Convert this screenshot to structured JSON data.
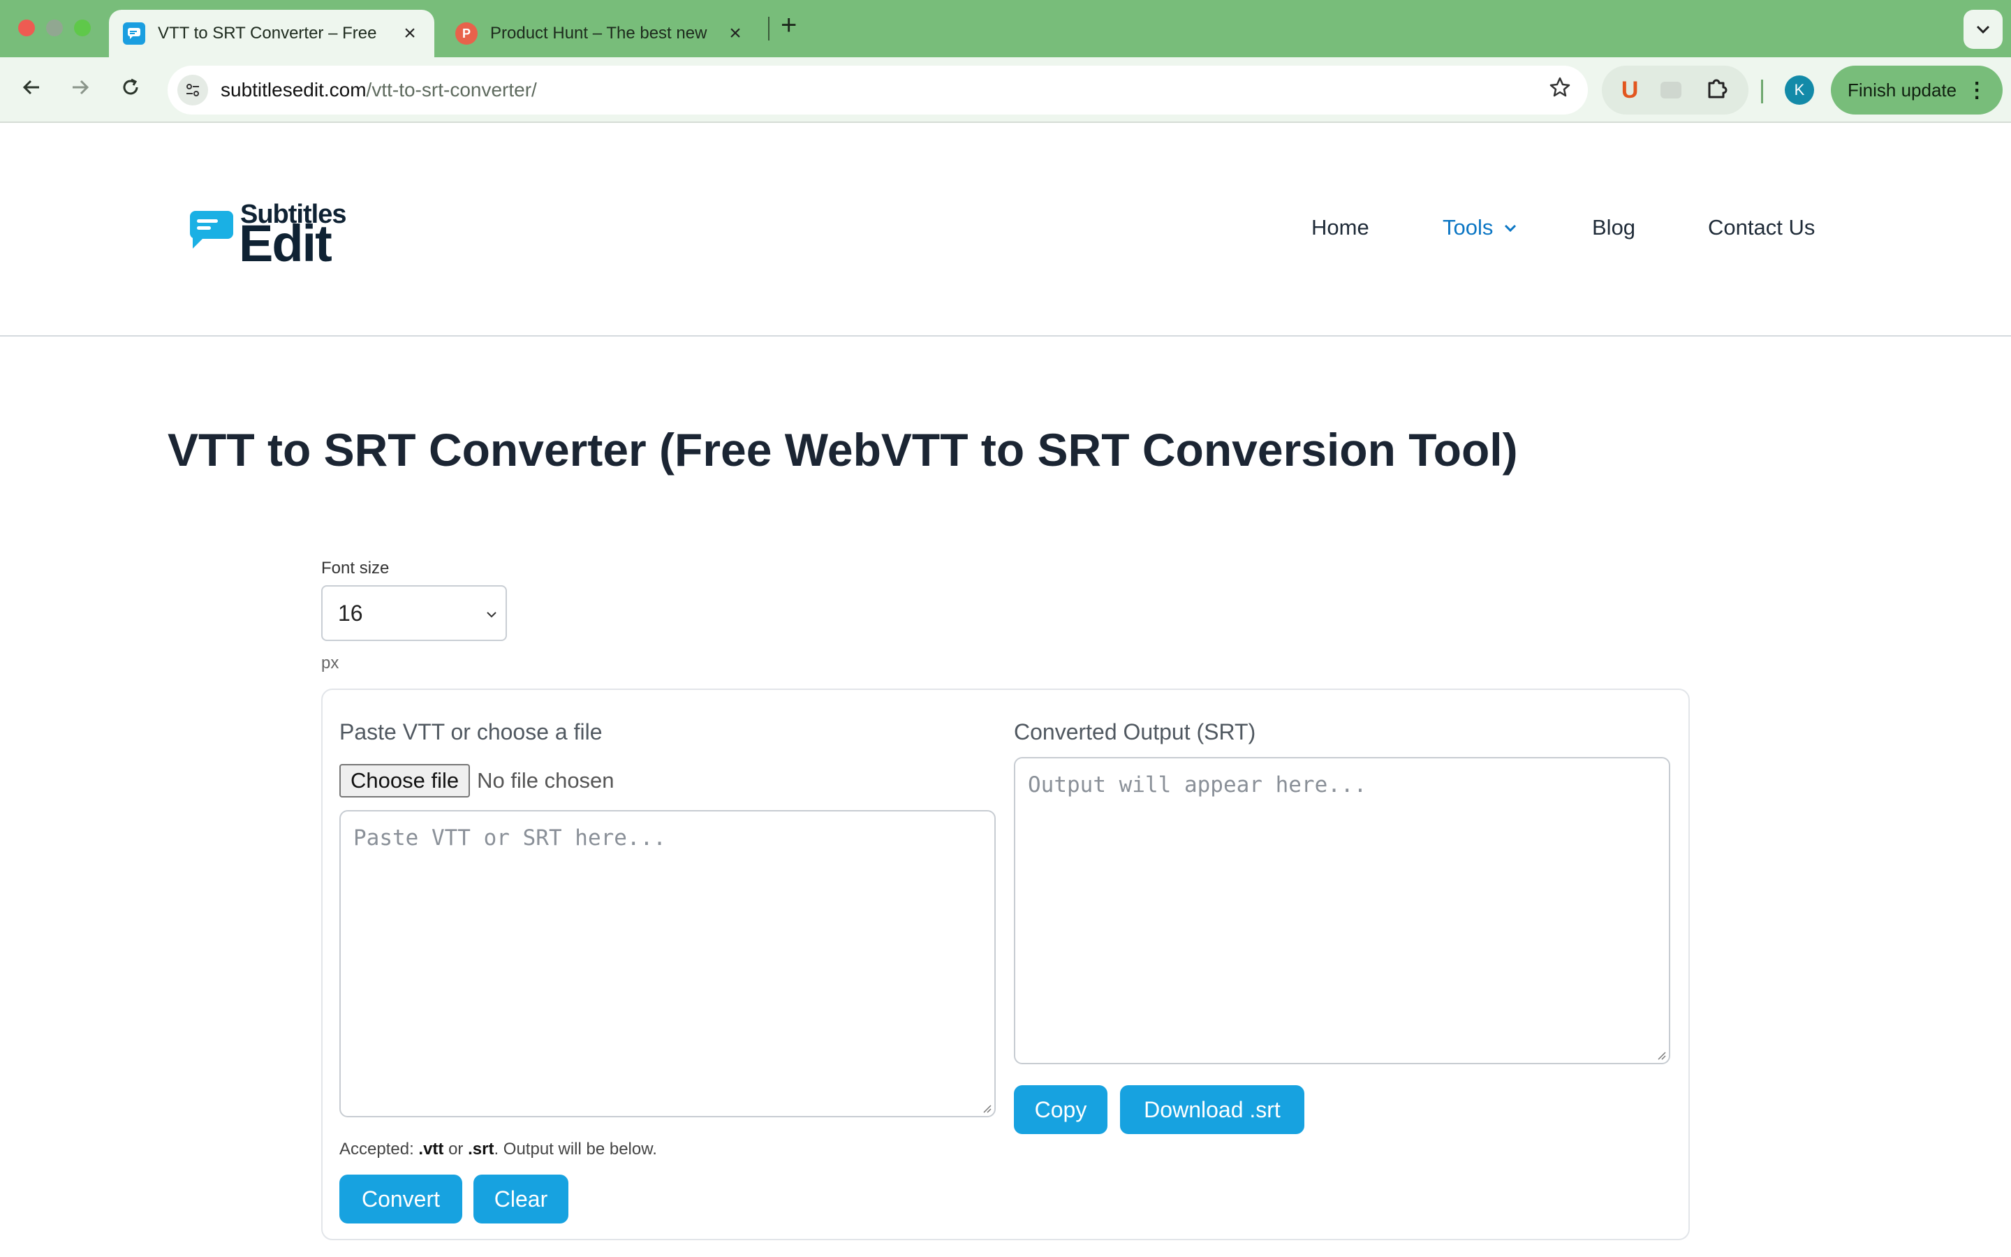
{
  "browser": {
    "tabs": [
      {
        "title": "VTT to SRT Converter – Free",
        "active": true,
        "favicon": "subtitles-edit-favicon"
      },
      {
        "title": "Product Hunt – The best new",
        "active": false,
        "favicon": "product-hunt-favicon",
        "favicon_letter": "P"
      }
    ],
    "url_domain": "subtitlesedit.com",
    "url_path": "/vtt-to-srt-converter/",
    "profile_initial": "K",
    "finish_update_label": "Finish update",
    "extension_letter": "U",
    "colors": {
      "chrome": "#78bd7a",
      "toolbar": "#eef6ee"
    }
  },
  "site": {
    "logo_line1": "Subtitles",
    "logo_line2": "Edit",
    "nav": {
      "home": "Home",
      "tools": "Tools",
      "blog": "Blog",
      "contact": "Contact Us"
    },
    "accent_color": "#17a2e0"
  },
  "main": {
    "title": "VTT to SRT Converter (Free WebVTT to SRT Conversion Tool)",
    "font_size": {
      "label": "Font size",
      "value": "16",
      "unit": "px"
    },
    "input": {
      "label": "Paste VTT or choose a file",
      "choose_file_label": "Choose file",
      "no_file_text": "No file chosen",
      "placeholder": "Paste VTT or SRT here...",
      "help_prefix": "Accepted: ",
      "help_ext1": ".vtt",
      "help_or": " or ",
      "help_ext2": ".srt",
      "help_suffix": ". Output will be below.",
      "convert_label": "Convert",
      "clear_label": "Clear"
    },
    "output": {
      "label": "Converted Output (SRT)",
      "placeholder": "Output will appear here...",
      "copy_label": "Copy",
      "download_label": "Download .srt"
    }
  }
}
